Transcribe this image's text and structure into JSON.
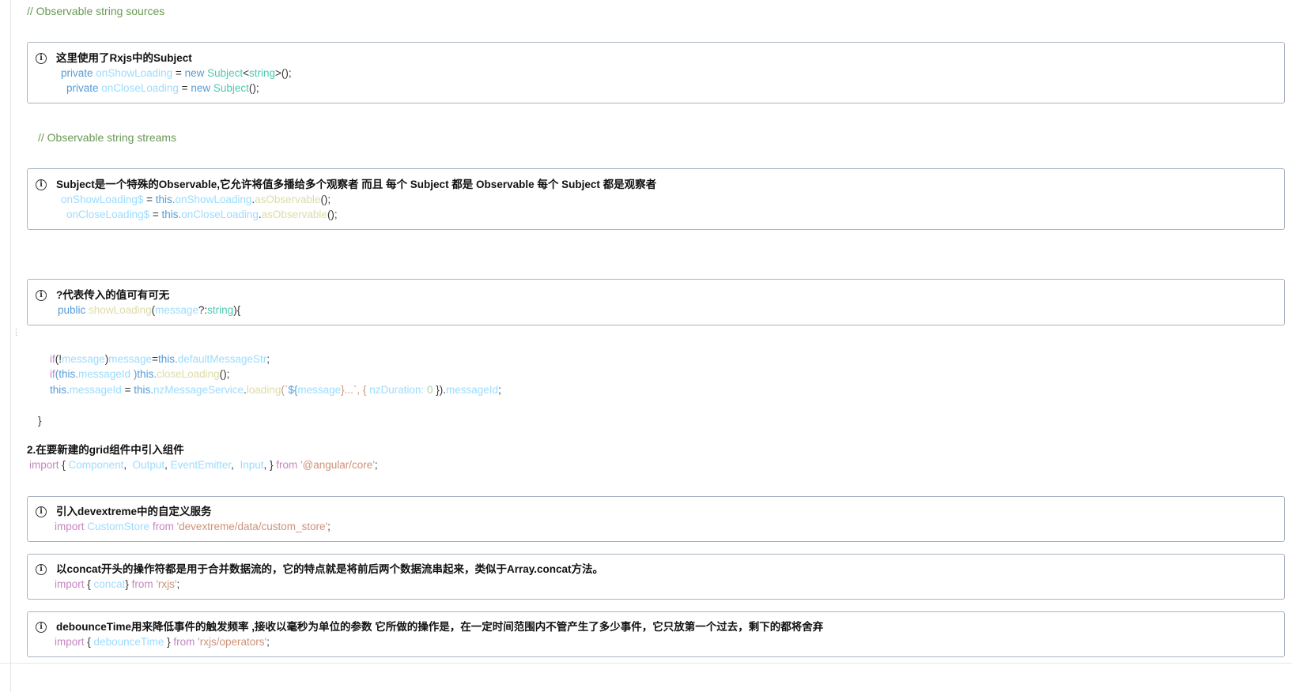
{
  "comments": {
    "sources": "// Observable string sources",
    "streams": "// Observable string streams"
  },
  "callouts": [
    {
      "title": "这里使用了Rxjs中的Subject",
      "lines": [
        [
          "private",
          "onShowLoading",
          "=",
          "new",
          "Subject",
          "<",
          "string",
          ">();"
        ],
        [
          "private",
          "onCloseLoading",
          "=",
          "new",
          "Subject",
          "();"
        ]
      ]
    },
    {
      "title": "Subject是一个特殊的Observable,它允许将值多播给多个观察者 而且 每个 Subject 都是 Observable 每个 Subject 都是观察者",
      "lines": [
        [
          "onShowLoading$",
          "=",
          "this.",
          "onShowLoading",
          ".",
          "asObservable",
          "();"
        ],
        [
          "onCloseLoading$",
          "=",
          "this.",
          "onCloseLoading",
          ".",
          "asObservable",
          "();"
        ]
      ]
    },
    {
      "title": "?代表传入的值可有可无",
      "lines": [
        [
          "public",
          "showLoading",
          "(",
          "message",
          "?:",
          "string",
          "){"
        ]
      ]
    },
    {
      "title": "引入devextreme中的自定义服务",
      "lines": [
        [
          "import",
          "CustomStore",
          "from",
          "'devextreme/data/custom_store'",
          ";"
        ]
      ]
    },
    {
      "title": "以concat开头的操作符都是用于合并数据流的，它的特点就是将前后两个数据流串起来，类似于Array.concat方法。",
      "lines": [
        [
          "import",
          "{ ",
          "concat",
          "} ",
          "from",
          "'rxjs'",
          ";"
        ]
      ]
    },
    {
      "title": "debounceTime用来降低事件的触发频率 ,接收以毫秒为单位的参数 它所做的操作是，在一定时间范围内不管产生了多少事件，它只放第一个过去，剩下的都将舍弃",
      "lines": [
        [
          "import",
          "{ ",
          "debounceTime",
          " } ",
          "from",
          "'rxjs/operators'",
          ";"
        ]
      ]
    }
  ],
  "body_code": {
    "line1": [
      "if",
      "(!",
      "message",
      ")",
      "message",
      "=",
      "this.",
      "defaultMessageStr",
      ";"
    ],
    "line2": [
      "if",
      "(this.",
      "messageId",
      " )this.",
      "closeLoading",
      "();"
    ],
    "line3": [
      "this.",
      "messageId",
      " = ",
      "this.",
      "nzMessageService",
      ".",
      "loading",
      "(`",
      "${",
      "message",
      "}...`, { ",
      "nzDuration: ",
      "0",
      " }).",
      "messageId",
      ";"
    ],
    "close_brace": "}"
  },
  "heading2": "2.在要新建的grid组件中引入组件",
  "import_line": [
    "import",
    " { ",
    "Component",
    ",  ",
    "Output",
    ", ",
    "EventEmitter",
    ",  ",
    "Input",
    ", } ",
    "from",
    " '@angular/core'",
    ";"
  ],
  "icon": "info-circle-icon",
  "colors": {
    "comment": "#6a9955",
    "keyword": "#569cd6",
    "import_keyword": "#c586c0",
    "identifier": "#9cdcfe",
    "type": "#4ec9b0",
    "function": "#dcdcaa",
    "string": "#ce9178",
    "callout_border": "#a9b4c2"
  }
}
